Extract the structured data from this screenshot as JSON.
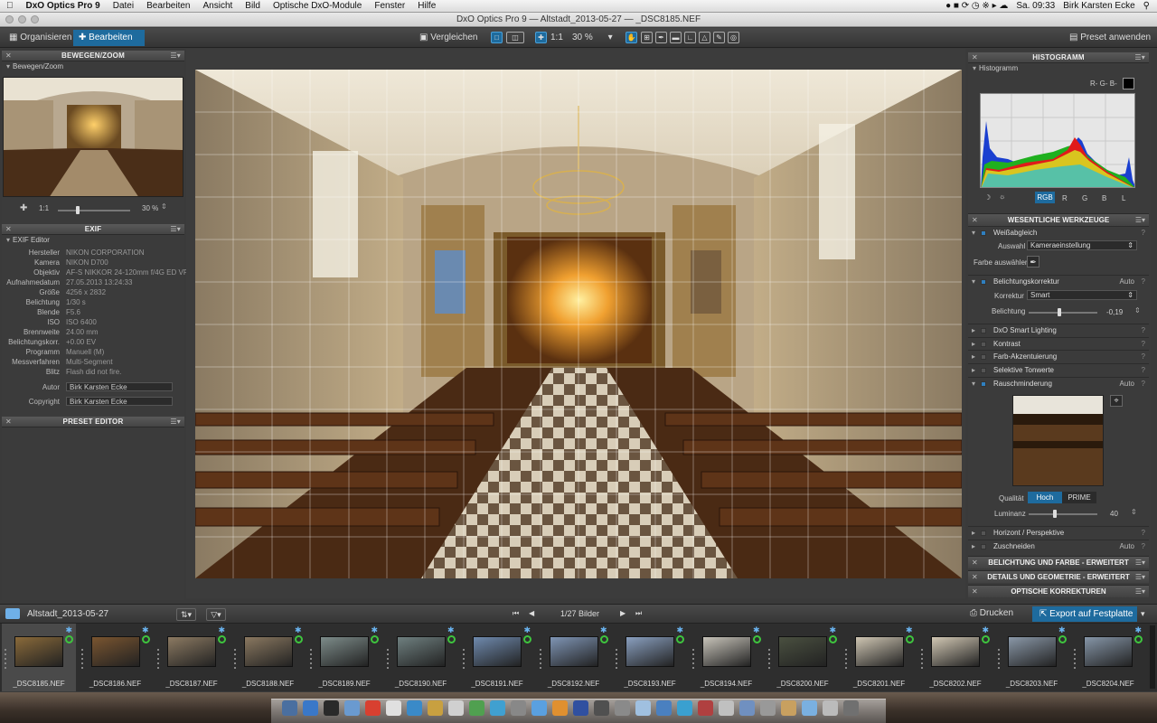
{
  "menubar": {
    "app": "DxO Optics Pro 9",
    "items": [
      "Datei",
      "Bearbeiten",
      "Ansicht",
      "Bild",
      "Optische DxO-Module",
      "Fenster",
      "Hilfe"
    ],
    "clock": "Sa. 09:33",
    "user": "Birk Karsten Ecke"
  },
  "window": {
    "title": "DxO Optics Pro 9 — Altstadt_2013-05-27 — _DSC8185.NEF"
  },
  "toolbar": {
    "tab_organize": "Organisieren",
    "tab_edit": "Bearbeiten",
    "compare": "Vergleichen",
    "one_to_one": "1:1",
    "zoom": "30 %",
    "apply_preset": "Preset anwenden"
  },
  "left": {
    "move_zoom": {
      "header": "BEWEGEN/ZOOM",
      "sub": "Bewegen/Zoom",
      "one_to_one": "1:1",
      "zoom": "30 %"
    },
    "exif": {
      "header": "EXIF",
      "sub": "EXIF Editor",
      "rows": [
        {
          "k": "Hersteller",
          "v": "NIKON CORPORATION"
        },
        {
          "k": "Kamera",
          "v": "NIKON D700"
        },
        {
          "k": "Objektiv",
          "v": "AF-S NIKKOR 24-120mm f/4G ED VR"
        },
        {
          "k": "Aufnahmedatum",
          "v": "27.05.2013 13:24:33"
        },
        {
          "k": "Größe",
          "v": "4256 x 2832"
        },
        {
          "k": "Belichtung",
          "v": "1/30 s"
        },
        {
          "k": "Blende",
          "v": "F5.6"
        },
        {
          "k": "ISO",
          "v": "ISO 6400"
        },
        {
          "k": "Brennweite",
          "v": "24.00 mm"
        },
        {
          "k": "Belichtungskorr.",
          "v": "+0.00 EV"
        },
        {
          "k": "Programm",
          "v": "Manuell (M)"
        },
        {
          "k": "Messverfahren",
          "v": "Multi-Segment"
        },
        {
          "k": "Blitz",
          "v": "Flash did not fire."
        }
      ],
      "author_label": "Autor",
      "author": "Birk Karsten Ecke",
      "copyright_label": "Copyright",
      "copyright": "Birk Karsten Ecke"
    },
    "preset_editor": {
      "header": "PRESET EDITOR"
    }
  },
  "right": {
    "histogram": {
      "header": "HISTOGRAMM",
      "sub": "Histogramm",
      "channels_label": "R- G- B-",
      "modes": [
        "RGB",
        "R",
        "G",
        "B",
        "L"
      ]
    },
    "essentials": {
      "header": "WESENTLICHE WERKZEUGE",
      "wb": {
        "name": "Weißabgleich",
        "select_label": "Auswahl",
        "select_value": "Kameraeinstellung",
        "pick_label": "Farbe auswählen"
      },
      "exposure": {
        "name": "Belichtungskorrektur",
        "auto": "Auto",
        "corr_label": "Korrektur",
        "corr_value": "Smart",
        "exp_label": "Belichtung",
        "exp_value": "-0,19"
      },
      "tools": [
        "DxO Smart Lighting",
        "Kontrast",
        "Farb-Akzentuierung",
        "Selektive Tonwerte"
      ],
      "noise": {
        "name": "Rauschminderung",
        "auto": "Auto",
        "quality_label": "Qualität",
        "q_high": "Hoch",
        "q_prime": "PRIME",
        "lum_label": "Luminanz",
        "lum_value": "40"
      },
      "horizon": "Horizont / Perspektive",
      "crop": {
        "name": "Zuschneiden",
        "auto": "Auto"
      }
    },
    "categories": [
      "BELICHTUNG UND FARBE - ERWEITERT",
      "DETAILS UND GEOMETRIE - ERWEITERT",
      "OPTISCHE KORREKTUREN"
    ]
  },
  "filmstrip": {
    "folder": "Altstadt_2013-05-27",
    "counter": "1/27 Bilder",
    "print": "Drucken",
    "export": "Export auf Festplatte",
    "thumbs": [
      {
        "name": "_DSC8185.NEF",
        "color": "#8a6a3a"
      },
      {
        "name": "_DSC8186.NEF",
        "color": "#7a5530"
      },
      {
        "name": "_DSC8187.NEF",
        "color": "#8c7a62"
      },
      {
        "name": "_DSC8188.NEF",
        "color": "#8a7860"
      },
      {
        "name": "_DSC8189.NEF",
        "color": "#7d8c8a"
      },
      {
        "name": "_DSC8190.NEF",
        "color": "#6f8080"
      },
      {
        "name": "_DSC8191.NEF",
        "color": "#6f8aae"
      },
      {
        "name": "_DSC8192.NEF",
        "color": "#7f95b5"
      },
      {
        "name": "_DSC8193.NEF",
        "color": "#8aa0c0"
      },
      {
        "name": "_DSC8194.NEF",
        "color": "#c8c4ba"
      },
      {
        "name": "_DSC8200.NEF",
        "color": "#4a5040"
      },
      {
        "name": "_DSC8201.NEF",
        "color": "#cfc6b3"
      },
      {
        "name": "_DSC8202.NEF",
        "color": "#d2c8b4"
      },
      {
        "name": "_DSC8203.NEF",
        "color": "#8a98a8"
      },
      {
        "name": "_DSC8204.NEF",
        "color": "#8696a8"
      }
    ]
  },
  "colors": {
    "accent": "#1e6b9e",
    "panel": "#3b3b3b",
    "ok_badge": "#3ec53e"
  }
}
